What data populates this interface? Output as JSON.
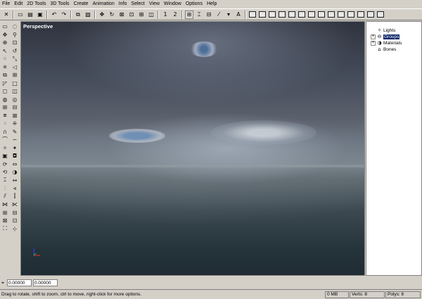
{
  "menu": [
    "File",
    "Edit",
    "2D Tools",
    "3D Tools",
    "Create",
    "Animation",
    "Info",
    "Select",
    "View",
    "Window",
    "Options",
    "Help"
  ],
  "toolbar": {
    "num1": "1",
    "num2": "2"
  },
  "viewport": {
    "title": "Perspective"
  },
  "tree": {
    "items": [
      {
        "label": "Lights",
        "expander": ""
      },
      {
        "label": "Groups",
        "expander": "+"
      },
      {
        "label": "Materials",
        "expander": "+"
      },
      {
        "label": "Bones",
        "expander": ""
      }
    ]
  },
  "coords": {
    "x_value": "0.00000",
    "y_value": "0.00000"
  },
  "status": {
    "hint": "Drag to rotate, shift to zoom, ctrl to move, right-click for more options.",
    "memory": "0 MB",
    "verts": "Verts: 8",
    "polys": "Polys: 6"
  }
}
